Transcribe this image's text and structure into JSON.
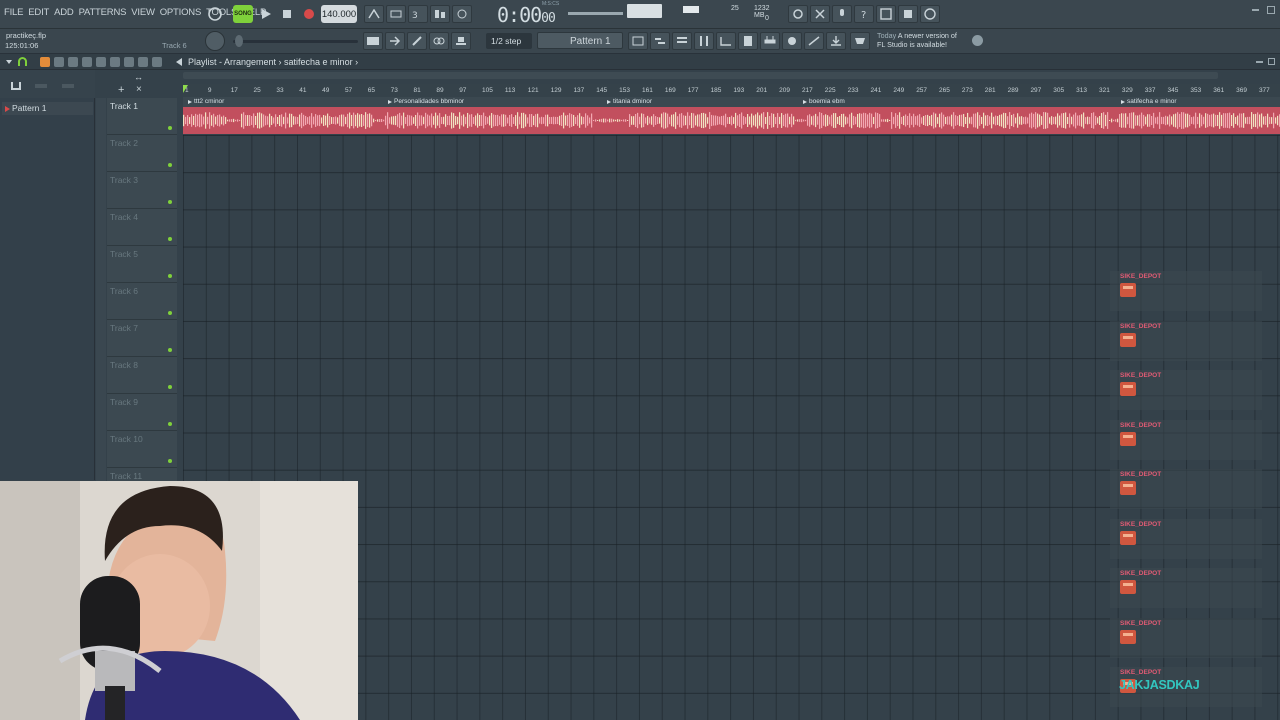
{
  "menu": [
    "FILE",
    "EDIT",
    "ADD",
    "PATTERNS",
    "VIEW",
    "OPTIONS",
    "TOOLS",
    "HELP"
  ],
  "transport": {
    "mode_label": "SONG",
    "tempo": "140.000",
    "time_main": "0:00",
    "time_sub": "00",
    "time_unit": "M:S:CS"
  },
  "cpu": {
    "value": "25",
    "memory": "1232 MB",
    "poly": "0"
  },
  "hint": {
    "title": "practikeç.flp",
    "position": "125:01:06",
    "track": "Track 6"
  },
  "step": "1/2 step",
  "pattern_selector": "Pattern 1",
  "news": {
    "day": "Today",
    "line1": "A newer version of",
    "line2": "FL Studio is available!"
  },
  "playlist": {
    "title": "Playlist - Arrangement › satifecha e minor ›"
  },
  "patterns": [
    "Pattern 1"
  ],
  "tracks": [
    "Track 1",
    "Track 2",
    "Track 3",
    "Track 4",
    "Track 5",
    "Track 6",
    "Track 7",
    "Track 8",
    "Track 9",
    "Track 10",
    "Track 11"
  ],
  "ruler_ticks": [
    "1",
    "9",
    "17",
    "25",
    "33",
    "41",
    "49",
    "57",
    "65",
    "73",
    "81",
    "89",
    "97",
    "105",
    "113",
    "121",
    "129",
    "137",
    "145",
    "153",
    "161",
    "169",
    "177",
    "185",
    "193",
    "201",
    "209",
    "217",
    "225",
    "233",
    "241",
    "249",
    "257",
    "265",
    "273",
    "281",
    "289",
    "297",
    "305",
    "313",
    "321",
    "329",
    "337",
    "345",
    "353",
    "361",
    "369",
    "377"
  ],
  "markers": [
    "ttt2 cminor",
    "Personalidades bbminor",
    "titania dminor",
    "boemia ebm",
    "satifecha e minor"
  ],
  "watermark_tags": [
    "SIKE_DEPOT",
    "SIKE_DEPOT",
    "SIKE_DEPOT",
    "SIKE_DEPOT",
    "SIKE_DEPOT",
    "SIKE_DEPOT",
    "SIKE_DEPOT",
    "SIKE_DEPOT",
    "SIKE_DEPOT"
  ],
  "watermark_big": "JAKJASDKAJ",
  "colors": {
    "clip": "#c24f5e",
    "wave_light": "#f1e3c2",
    "accent_green": "#7fd13b",
    "tag_pink": "#e25b74",
    "tag_teal": "#32c6c0"
  }
}
